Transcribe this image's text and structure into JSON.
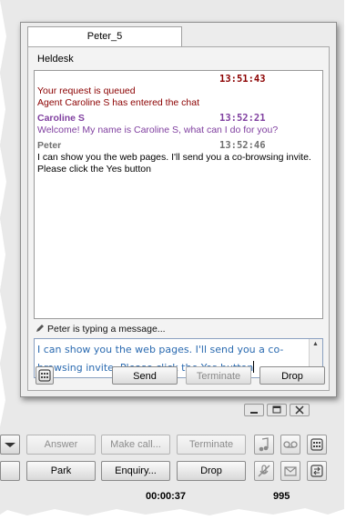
{
  "chat": {
    "tab_label": "Peter_5",
    "department": "Heldesk",
    "messages": [
      {
        "time": "13:51:43",
        "sender": "",
        "lines": [
          "Your request is queued",
          "Agent Caroline S has entered the chat"
        ]
      },
      {
        "time": "13:52:21",
        "sender": "Caroline S",
        "lines": [
          "Welcome! My name is Caroline S, what can I do for you?"
        ]
      },
      {
        "time": "13:52:46",
        "sender": "Peter",
        "lines": [
          "I can show you the web pages. I'll send you a co-browsing invite.",
          "Please click the Yes button"
        ]
      }
    ],
    "typing_status": "Peter is typing a message...",
    "compose_text": "I can show you the web pages. I'll send you a co-browsing invite. Please click the Yes button",
    "buttons": {
      "send": "Send",
      "terminate": "Terminate",
      "drop": "Drop"
    },
    "colors": {
      "system": "#8b0000",
      "agent": "#8040a0",
      "customer": "#707070",
      "compose_text": "#2a6ab0"
    }
  },
  "phone": {
    "row1": {
      "answer": "Answer",
      "make_call": "Make call...",
      "terminate": "Terminate"
    },
    "row2": {
      "park": "Park",
      "enquiry": "Enquiry...",
      "drop": "Drop"
    },
    "status": {
      "timer": "00:00:37",
      "count": "995"
    },
    "icons": [
      "music-note-icon",
      "voicemail-icon",
      "keypad-phone-icon",
      "no-microphone-icon",
      "envelope-icon",
      "transfer-icon",
      "minimize-icon",
      "restore-icon",
      "close-icon"
    ]
  }
}
